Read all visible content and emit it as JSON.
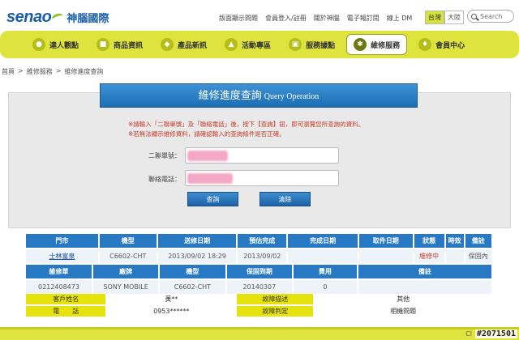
{
  "header": {
    "logo_brand": "senao",
    "logo_cn": "神腦國際",
    "links": [
      "版面顯示問題",
      "會員登入/註冊",
      "關於神腦",
      "電子報訂閱",
      "線上 DM"
    ],
    "lang": [
      "台灣",
      "大陸"
    ],
    "search_placeholder": "Search"
  },
  "nav": {
    "items": [
      {
        "label": "達人觀點",
        "icon": "people-icon"
      },
      {
        "label": "商品資訊",
        "icon": "box-icon"
      },
      {
        "label": "產品新訊",
        "icon": "tag-icon"
      },
      {
        "label": "活動專區",
        "icon": "megaphone-icon"
      },
      {
        "label": "服務據點",
        "icon": "store-icon"
      },
      {
        "label": "維修服務",
        "icon": "gear-icon"
      },
      {
        "label": "會員中心",
        "icon": "member-icon"
      }
    ]
  },
  "breadcrumb": [
    "首頁",
    ">",
    "維修服務",
    ">",
    "維修進度查詢"
  ],
  "panel": {
    "title": "維修進度查詢",
    "title_en": "Query Operation",
    "note1": "※請輸入「二聯單號」及「聯絡電話」後，按下【查詢】鈕，即可瀏覽您所查詢的資料。",
    "note2": "※若無法顯示維修資料，請確認輸入的查詢條件是否正確。",
    "field1_label": "二聯單號：",
    "field2_label": "聯絡電話：",
    "query_button": "查詢",
    "clear_button": "清除"
  },
  "table1": {
    "headers": [
      "門市",
      "機型",
      "送修日期",
      "預估完成",
      "完成日期",
      "取件日期",
      "狀態",
      "時效",
      "備註"
    ],
    "row": [
      "士林富泉",
      "C6602-CHT",
      "2013/09/02 18:29",
      "2013/09/02",
      "",
      "",
      "維修中",
      "",
      "保固內"
    ]
  },
  "table2": {
    "headers": [
      "維修單",
      "廠牌",
      "機型",
      "保固到期",
      "費用",
      "備註"
    ],
    "row": [
      "0212408473",
      "SONY MOBILE",
      "C6602-CHT",
      "20140307",
      "0",
      ""
    ]
  },
  "info": {
    "customer_label": "客戶姓名",
    "customer_value": "黃**",
    "phone_label": "電　　話",
    "phone_value": "0953******",
    "fault_desc_label": "故障描述",
    "fault_desc_value": "其他",
    "fault_judge_label": "故障判定",
    "fault_judge_value": "相機問題"
  },
  "footer_text": "Cl",
  "watermark": "#2071501",
  "colors": {
    "nav_bg": "#dfe33e",
    "header_blue": "#2779c4",
    "note_red": "#c43a2a"
  }
}
